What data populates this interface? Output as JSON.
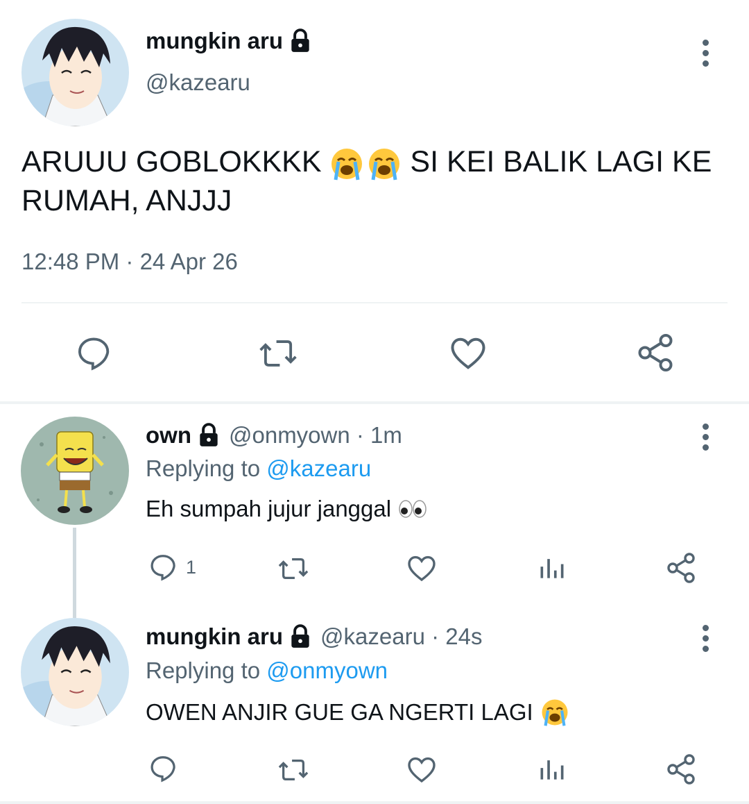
{
  "main_tweet": {
    "display_name": "mungkin aru",
    "handle": "@kazearu",
    "text_part1": "ARUUU GOBLOKKKK",
    "text_part2": "SI KEI BALIK LAGI KE",
    "text_part3": "RUMAH, ANJJJ",
    "emoji": [
      "loudly-crying-face",
      "loudly-crying-face"
    ],
    "timestamp": "12:48 PM · 24 Apr 26",
    "actions": [
      "reply-icon",
      "retweet-icon",
      "like-icon",
      "share-icon"
    ]
  },
  "replies": [
    {
      "display_name": "own",
      "handle_time": "@onmyown · 1m",
      "replying_prefix": "Replying to",
      "replying_to": "@kazearu",
      "text": "Eh sumpah jujur janggal",
      "emoji": "eyes",
      "reply_count": "1"
    },
    {
      "display_name": "mungkin aru",
      "handle_time": "@kazearu · 24s",
      "replying_prefix": "Replying to",
      "replying_to": "@onmyown",
      "text": "OWEN ANJIR GUE GA NGERTI LAGI",
      "emoji": "loudly-crying-face"
    }
  ],
  "colors": {
    "text": "#0f1419",
    "secondary": "#536471",
    "link": "#1d9bf0",
    "divider": "#eff3f4"
  }
}
